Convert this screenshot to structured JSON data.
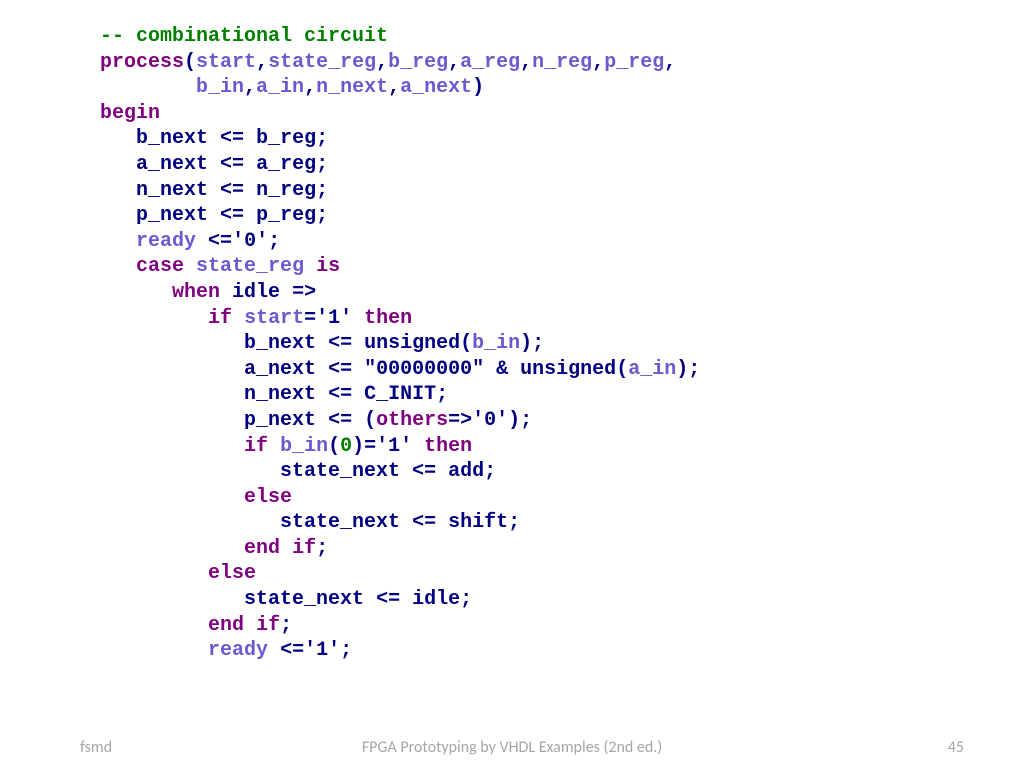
{
  "footer": {
    "left": "fsmd",
    "center": "FPGA Prototyping by VHDL Examples (2nd ed.)",
    "right": "45"
  },
  "code": {
    "c01": "-- combinational circuit",
    "kw": {
      "process": "process",
      "begin": "begin",
      "case": "case",
      "is": "is",
      "when": "when",
      "if": "if",
      "then": "then",
      "else": "else",
      "end": "end",
      "others": "others"
    },
    "p": {
      "start": "start",
      "state_reg": "state_reg",
      "b_reg": "b_reg",
      "a_reg": "a_reg",
      "n_reg": "n_reg",
      "p_reg": "p_reg",
      "b_in": "b_in",
      "a_in": "a_in",
      "n_next": "n_next",
      "a_next": "a_next",
      "ready": "ready"
    },
    "id": {
      "b_next": "b_next",
      "a_next": "a_next",
      "n_next": "n_next",
      "p_next": "p_next",
      "b_reg": "b_reg",
      "a_reg": "a_reg",
      "n_reg": "n_reg",
      "p_reg": "p_reg",
      "state_reg": "state_reg",
      "idle": "idle",
      "unsigned": "unsigned",
      "C_INIT": "C_INIT",
      "state_next": "state_next",
      "add": "add",
      "shift": "shift"
    },
    "str": {
      "zero": "'0'",
      "one": "'1'",
      "zeros8": "\"00000000\""
    },
    "num": {
      "zero": "0"
    },
    "op": {
      "assign": "<=",
      "arrow": "=>",
      "eq": "=",
      "amp": "&",
      "semi": ";",
      "comma": ",",
      "lpar": "(",
      "rpar": ")"
    }
  }
}
